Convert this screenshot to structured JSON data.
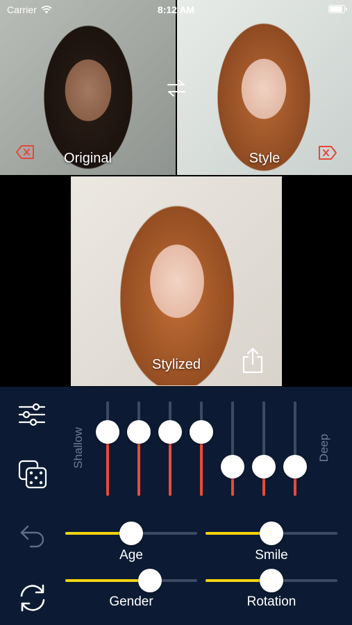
{
  "status_bar": {
    "carrier": "Carrier",
    "time": "8:12 AM"
  },
  "images": {
    "original_label": "Original",
    "style_label": "Style",
    "stylized_label": "Stylized"
  },
  "controls": {
    "depth_low_label": "Shallow",
    "depth_high_label": "Deep",
    "layer_sliders": [
      0.68,
      0.68,
      0.68,
      0.68,
      0.31,
      0.31,
      0.31
    ],
    "sliders": [
      {
        "label": "Age",
        "value": 0.5
      },
      {
        "label": "Smile",
        "value": 0.5
      },
      {
        "label": "Gender",
        "value": 0.64
      },
      {
        "label": "Rotation",
        "value": 0.5
      }
    ]
  },
  "colors": {
    "panel_bg": "#0c1b33",
    "layer_fill": "#e84b3c",
    "slider_fill": "#f3d40f",
    "delete_icon": "#e8463a"
  },
  "icons": [
    "wifi-icon",
    "battery-icon",
    "swap-icon",
    "delete-icon",
    "share-icon",
    "sliders-icon",
    "dice-icon",
    "undo-icon",
    "refresh-icon"
  ]
}
